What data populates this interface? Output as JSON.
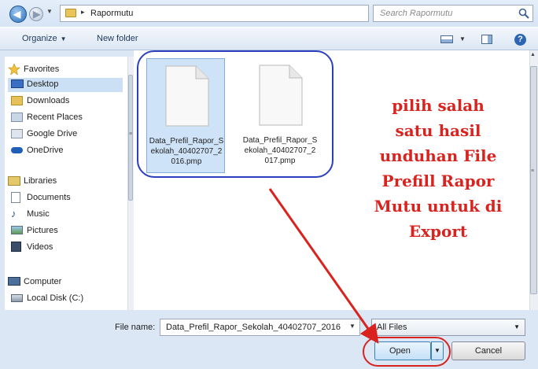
{
  "address_bar": {
    "current_folder": "Rapormutu",
    "search_placeholder": "Search Rapormutu"
  },
  "toolbar": {
    "organize_label": "Organize",
    "new_folder_label": "New folder"
  },
  "nav_pane": {
    "favorites_label": "Favorites",
    "favorites": [
      {
        "label": "Desktop",
        "icon": "desktop-icon"
      },
      {
        "label": "Downloads",
        "icon": "downloads-icon"
      },
      {
        "label": "Recent Places",
        "icon": "recent-places-icon"
      },
      {
        "label": "Google Drive",
        "icon": "google-drive-icon"
      },
      {
        "label": "OneDrive",
        "icon": "onedrive-icon"
      }
    ],
    "libraries_label": "Libraries",
    "libraries": [
      {
        "label": "Documents",
        "icon": "documents-icon"
      },
      {
        "label": "Music",
        "icon": "music-icon"
      },
      {
        "label": "Pictures",
        "icon": "pictures-icon"
      },
      {
        "label": "Videos",
        "icon": "videos-icon"
      }
    ],
    "computer_label": "Computer",
    "computer": [
      {
        "label": "Local Disk (C:)",
        "icon": "local-disk-icon"
      }
    ]
  },
  "files": [
    {
      "name": "Data_Prefil_Rapor_Sekolah_40402707_2016.pmp",
      "selected": true
    },
    {
      "name": "Data_Prefil_Rapor_Sekolah_40402707_2017.pmp",
      "selected": false
    }
  ],
  "annotation": {
    "lines": [
      "pilih salah",
      "satu hasil",
      "unduhan File",
      "Prefill Rapor",
      "Mutu untuk di",
      "Export"
    ],
    "color": "#d8231f"
  },
  "bottom": {
    "file_name_label": "File name:",
    "file_name_value": "Data_Prefil_Rapor_Sekolah_40402707_2016",
    "filter_value": "All Files",
    "open_label": "Open",
    "cancel_label": "Cancel"
  },
  "colors": {
    "selection_oval": "#2b3fbf",
    "highlight_red": "#d8231f",
    "selected_bg": "#cfe3f8"
  }
}
